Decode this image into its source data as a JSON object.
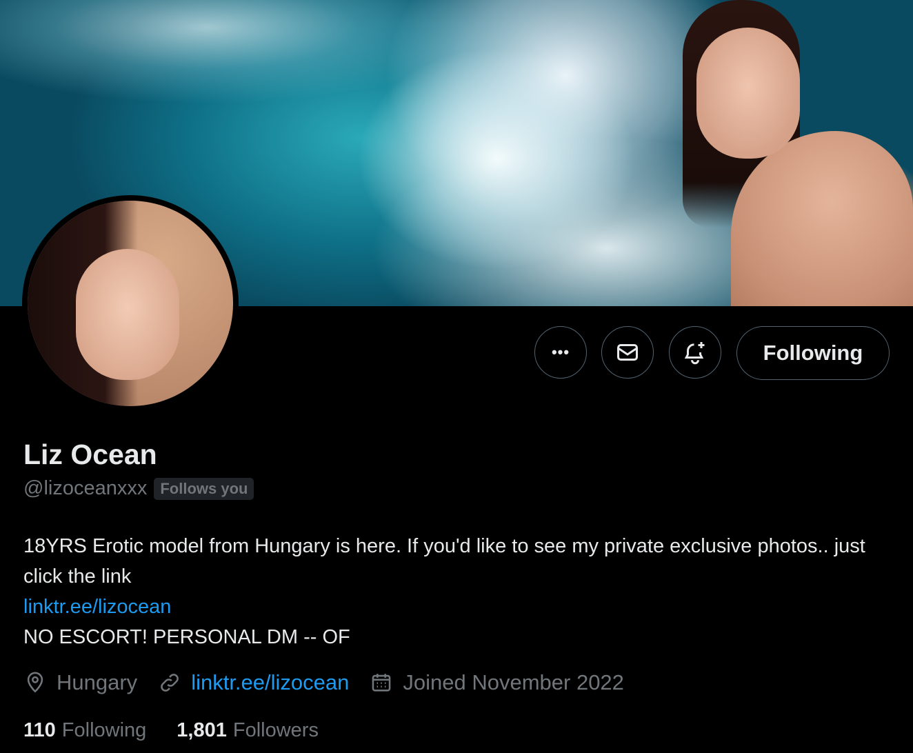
{
  "profile": {
    "name": "Liz Ocean",
    "handle": "@lizoceanxxx",
    "follows_you": "Follows you",
    "bio_line1": "18YRS Erotic model from Hungary is here. If you'd like to see my private exclusive photos.. just click the link",
    "bio_link": "linktr.ee/lizocean",
    "bio_line3": "NO ESCORT! PERSONAL DM -- OF",
    "location": "Hungary",
    "website": "linktr.ee/lizocean",
    "joined": "Joined November 2022",
    "following_count": "110",
    "following_label": "Following",
    "followers_count": "1,801",
    "followers_label": "Followers"
  },
  "actions": {
    "more": "•••",
    "follow_state": "Following"
  },
  "icons": {
    "more": "more-icon",
    "message": "envelope-icon",
    "notify": "bell-plus-icon",
    "location": "location-pin-icon",
    "link": "link-icon",
    "calendar": "calendar-icon"
  },
  "colors": {
    "background": "#000000",
    "text": "#e7e9ea",
    "secondary": "#71767b",
    "link": "#1d9bf0",
    "border": "#536471"
  }
}
